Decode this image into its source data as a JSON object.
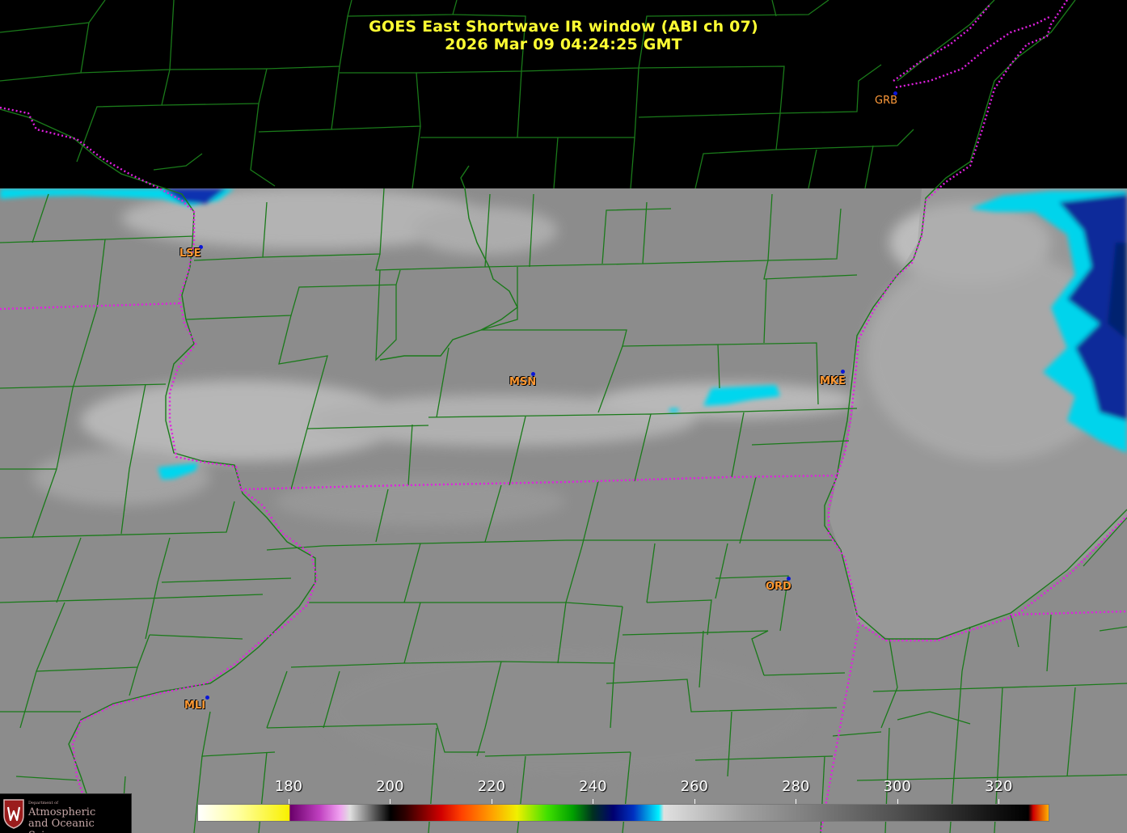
{
  "header": {
    "title": "GOES East Shortwave IR window (ABI ch 07)",
    "timestamp": "2026 Mar 09  04:24:25 GMT"
  },
  "stations": [
    {
      "code": "GRB"
    },
    {
      "code": "LSE"
    },
    {
      "code": "MSN"
    },
    {
      "code": "MKE"
    },
    {
      "code": "ORD"
    },
    {
      "code": "MLI"
    }
  ],
  "colorbar": {
    "ticks": [
      "180",
      "200",
      "220",
      "240",
      "260",
      "280",
      "300",
      "320"
    ],
    "range": [
      162,
      330
    ]
  },
  "colors": {
    "title": "#ffff33",
    "station_label": "#ff9933",
    "station_dot": "#0a16d8",
    "county_lines": "#1a7a1a",
    "state_lines": "#e020e0",
    "cloud_cyan": "#00e0f0",
    "cloud_blue": "#0a2aa0"
  },
  "logo": {
    "dept": "Department of",
    "line1": "Atmospheric",
    "line2": "and Oceanic Sciences"
  }
}
